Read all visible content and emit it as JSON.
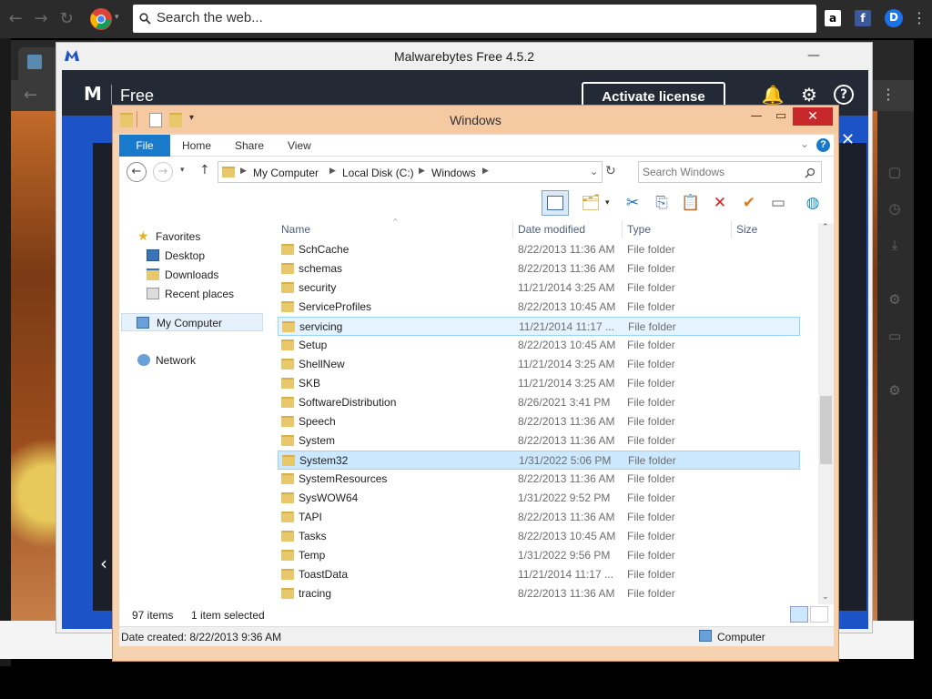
{
  "chrome": {
    "omnibox_placeholder": "Search the web...",
    "ext_amazon": "a",
    "ext_facebook": "f",
    "ext_profile": "D"
  },
  "malwarebytes": {
    "title": "Malwarebytes Free  4.5.2",
    "logo": "M",
    "edition": "Free",
    "activate_label": "Activate license",
    "accent_color": "#1c54c8",
    "header_color": "#232a35"
  },
  "explorer": {
    "title": "Windows",
    "ribbon_tabs": [
      "File",
      "Home",
      "Share",
      "View"
    ],
    "address_crumbs": [
      "My Computer",
      "Local Disk (C:)",
      "Windows"
    ],
    "search_placeholder": "Search Windows",
    "nav": {
      "favorites": "Favorites",
      "desktop": "Desktop",
      "downloads": "Downloads",
      "recent": "Recent places",
      "my_computer": "My Computer",
      "network": "Network"
    },
    "columns": [
      "Name",
      "Date modified",
      "Type",
      "Size"
    ],
    "rows": [
      {
        "name": "SchCache",
        "date": "8/22/2013 11:36 AM",
        "type": "File folder"
      },
      {
        "name": "schemas",
        "date": "8/22/2013 11:36 AM",
        "type": "File folder"
      },
      {
        "name": "security",
        "date": "11/21/2014 3:25 AM",
        "type": "File folder"
      },
      {
        "name": "ServiceProfiles",
        "date": "8/22/2013 10:45 AM",
        "type": "File folder"
      },
      {
        "name": "servicing",
        "date": "11/21/2014 11:17 ...",
        "type": "File folder"
      },
      {
        "name": "Setup",
        "date": "8/22/2013 10:45 AM",
        "type": "File folder"
      },
      {
        "name": "ShellNew",
        "date": "11/21/2014 3:25 AM",
        "type": "File folder"
      },
      {
        "name": "SKB",
        "date": "11/21/2014 3:25 AM",
        "type": "File folder"
      },
      {
        "name": "SoftwareDistribution",
        "date": "8/26/2021 3:41 PM",
        "type": "File folder"
      },
      {
        "name": "Speech",
        "date": "8/22/2013 11:36 AM",
        "type": "File folder"
      },
      {
        "name": "System",
        "date": "8/22/2013 11:36 AM",
        "type": "File folder"
      },
      {
        "name": "System32",
        "date": "1/31/2022 5:06 PM",
        "type": "File folder"
      },
      {
        "name": "SystemResources",
        "date": "8/22/2013 11:36 AM",
        "type": "File folder"
      },
      {
        "name": "SysWOW64",
        "date": "1/31/2022 9:52 PM",
        "type": "File folder"
      },
      {
        "name": "TAPI",
        "date": "8/22/2013 11:36 AM",
        "type": "File folder"
      },
      {
        "name": "Tasks",
        "date": "8/22/2013 10:45 AM",
        "type": "File folder"
      },
      {
        "name": "Temp",
        "date": "1/31/2022 9:56 PM",
        "type": "File folder"
      },
      {
        "name": "ToastData",
        "date": "11/21/2014 11:17 ...",
        "type": "File folder"
      },
      {
        "name": "tracing",
        "date": "8/22/2013 11:36 AM",
        "type": "File folder"
      }
    ],
    "status": {
      "item_count": "97 items",
      "selection": "1 item selected"
    },
    "details": {
      "date_created": "Date created: 8/22/2013 9:36 AM",
      "location": "Computer"
    }
  }
}
